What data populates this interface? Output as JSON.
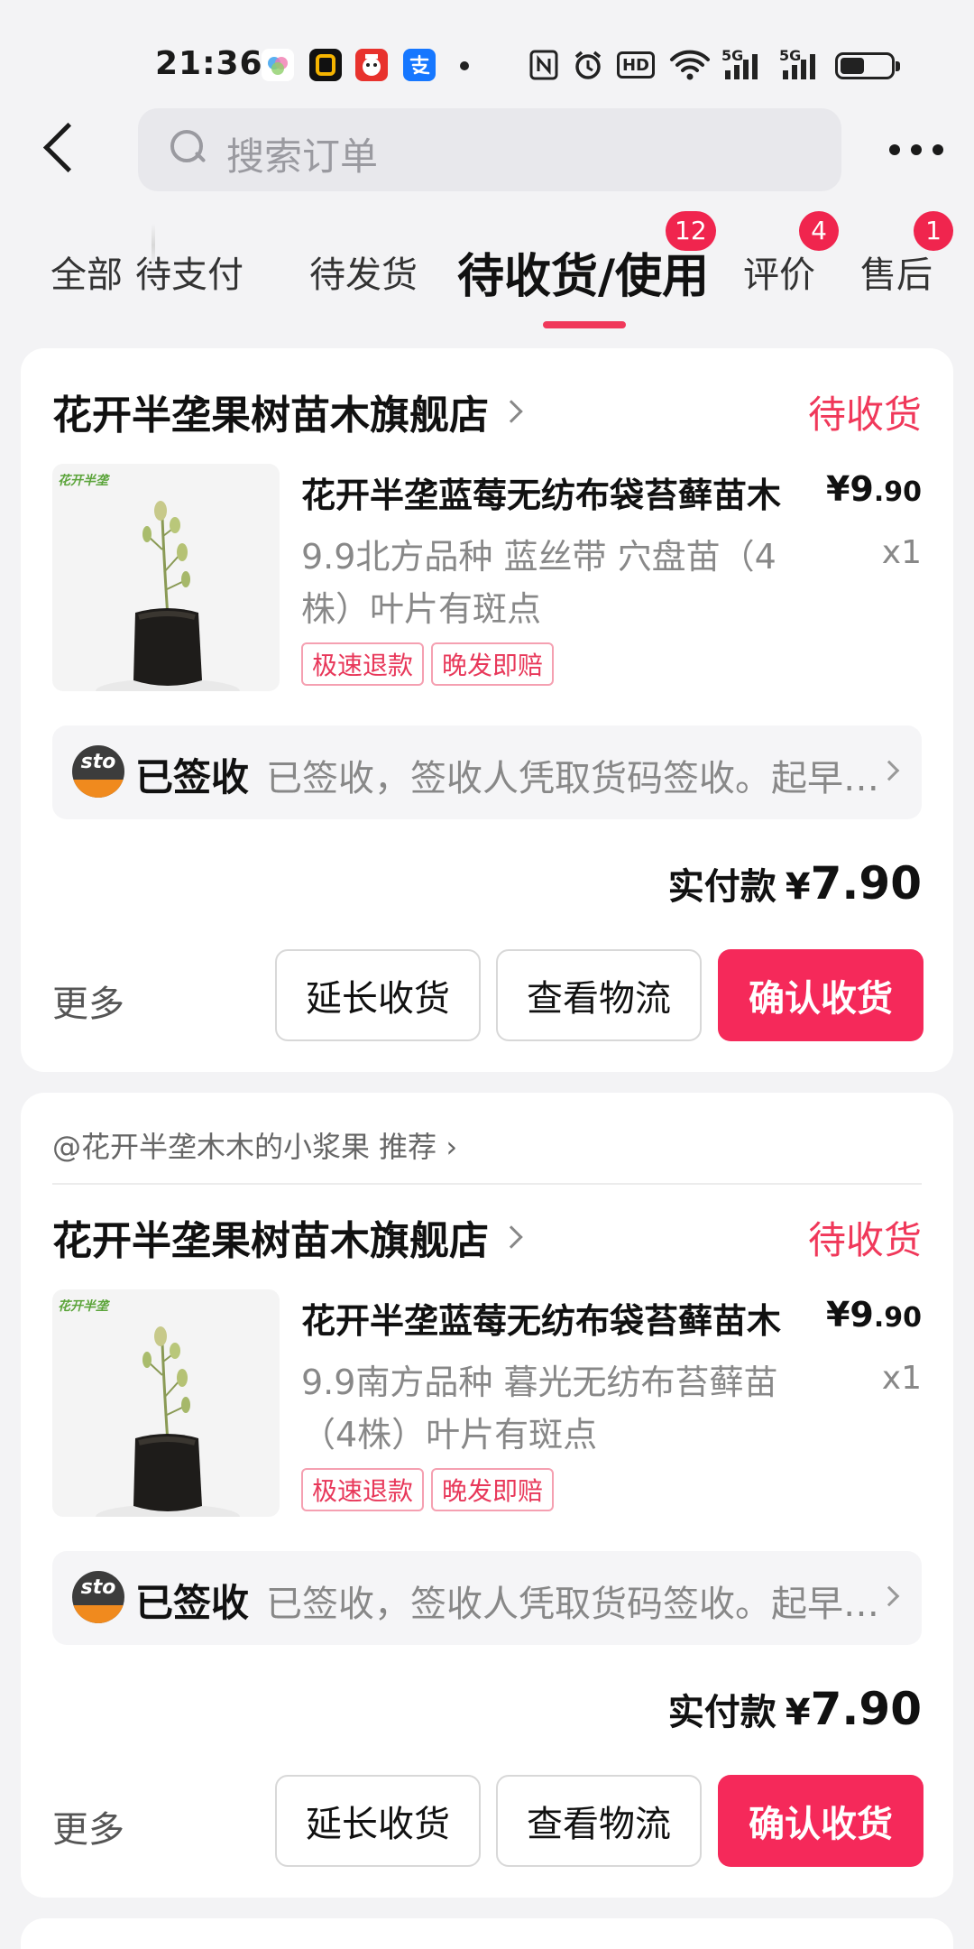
{
  "status_bar": {
    "time": "21:36",
    "app_icons": [
      "cloud-app-icon",
      "o-app-icon",
      "1111-app-icon",
      "alipay-app-icon"
    ],
    "sys_icons": [
      "nfc-icon",
      "alarm-icon",
      "hd-icon",
      "wifi-icon",
      "5g-signal-icon",
      "5g-signal-icon",
      "battery-icon"
    ],
    "hd_label": "HD",
    "sig1_label": "5G",
    "sig2_label": "5G"
  },
  "header": {
    "search_placeholder": "搜索订单"
  },
  "tabs": [
    {
      "label": "全部",
      "badge": ""
    },
    {
      "label": "待支付",
      "badge": ""
    },
    {
      "label": "待发货",
      "badge": ""
    },
    {
      "label": "待收货/使用",
      "badge": "12",
      "active": true
    },
    {
      "label": "评价",
      "badge": "4"
    },
    {
      "label": "售后",
      "badge": "1"
    }
  ],
  "orders": [
    {
      "recommend": "",
      "shop_name": "花开半垄果树苗木旗舰店",
      "status": "待收货",
      "product_title": "花开半垄蓝莓无纺布袋苔藓苗木",
      "product_brand": "花开半垄",
      "price_int": "¥9",
      "price_dec": ".90",
      "spec": "9.9北方品种 蓝丝带 穴盘苗（4株）叶片有斑点",
      "qty": "x1",
      "tags": [
        "极速退款",
        "晚发即赔"
      ],
      "logistics_status": "已签收",
      "logistics_detail": "已签收，签收人凭取货码签收。起早贪黑",
      "courier_logo_text": "sto",
      "paid_label": "实付款",
      "paid_yen": "¥",
      "paid_amount": "7.90",
      "more_label": "更多",
      "buttons": [
        "延长收货",
        "查看物流",
        "确认收货"
      ]
    },
    {
      "recommend": "@花开半垄木木的小浆果 推荐 ›",
      "shop_name": "花开半垄果树苗木旗舰店",
      "status": "待收货",
      "product_title": "花开半垄蓝莓无纺布袋苔藓苗木",
      "product_brand": "花开半垄",
      "price_int": "¥9",
      "price_dec": ".90",
      "spec": "9.9南方品种 暮光无纺布苔藓苗（4株）叶片有斑点",
      "qty": "x1",
      "tags": [
        "极速退款",
        "晚发即赔"
      ],
      "logistics_status": "已签收",
      "logistics_detail": "已签收，签收人凭取货码签收。起早贪黑",
      "courier_logo_text": "sto",
      "paid_label": "实付款",
      "paid_yen": "¥",
      "paid_amount": "7.90",
      "more_label": "更多",
      "buttons": [
        "延长收货",
        "查看物流",
        "确认收货"
      ]
    }
  ]
}
